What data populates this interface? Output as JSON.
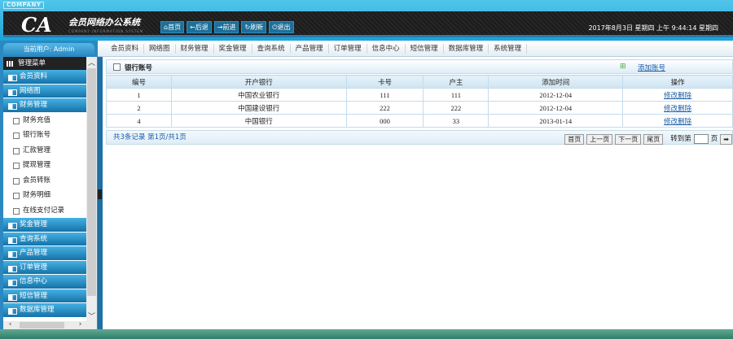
{
  "header": {
    "company": "COMPANY",
    "logo": "CA",
    "title": "会员网络办公系统",
    "subtitle": "COMPANY INFORMATION SYSTEM",
    "buttons": [
      "⌂首页",
      "←后退",
      "→前进",
      "↻刷新",
      "⏻退出"
    ],
    "datetime": "2017年8月3日 星期四 上午 9:44:14 星期四"
  },
  "topnav": [
    "会员资料",
    "网络图",
    "财务管理",
    "奖金管理",
    "查询系统",
    "产品管理",
    "订单管理",
    "信息中心",
    "短信管理",
    "数据库管理",
    "系统管理"
  ],
  "sidebar": {
    "user": "当前用户: Admin",
    "menu_title": "管理菜单",
    "groups_before": [
      "会员资料",
      "网络图",
      "财务管理"
    ],
    "sub_items": [
      "财务充值",
      "银行账号",
      "汇款管理",
      "提现管理",
      "会员转账",
      "财务明细",
      "在线支付记录"
    ],
    "groups_after": [
      "奖金管理",
      "查询系统",
      "产品管理",
      "订单管理",
      "信息中心",
      "短信管理",
      "数据库管理"
    ]
  },
  "panel": {
    "title": "银行账号",
    "add_label": "添加账号",
    "columns": [
      "编号",
      "开户银行",
      "卡号",
      "户主",
      "添加时间",
      "操作"
    ],
    "rows": [
      [
        "1",
        "中国农业银行",
        "111",
        "111",
        "2012-12-04",
        "修改删除"
      ],
      [
        "2",
        "中国建设银行",
        "222",
        "222",
        "2012-12-04",
        "修改删除"
      ],
      [
        "4",
        "中国银行",
        "000",
        "33",
        "2013-01-14",
        "修改删除"
      ]
    ],
    "summary": "共3条记录 第1页/共1页",
    "pager": {
      "first": "首页",
      "prev": "上一页",
      "next": "下一页",
      "last": "尾页",
      "goto": "转到第",
      "page": "页",
      "go": "➡"
    }
  }
}
